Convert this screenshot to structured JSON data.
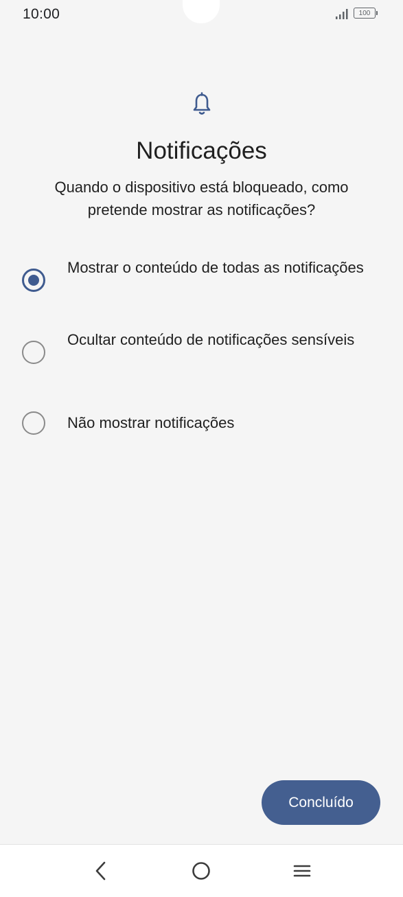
{
  "status_bar": {
    "time": "10:00",
    "battery": "100"
  },
  "header": {
    "icon": "bell-icon",
    "title": "Notificações",
    "subtitle": "Quando o dispositivo está bloqueado, como pretende mostrar as notificações?"
  },
  "options": [
    {
      "label": "Mostrar o conteúdo de todas as notificações",
      "selected": true
    },
    {
      "label": "Ocultar conteúdo de notificações sensíveis",
      "selected": false
    },
    {
      "label": "Não mostrar notificações",
      "selected": false
    }
  ],
  "actions": {
    "done_label": "Concluído"
  },
  "nav_bar": {
    "back_icon": "chevron-left-icon",
    "home_icon": "circle-home-icon",
    "menu_icon": "hamburger-menu-icon"
  },
  "colors": {
    "accent": "#445f90",
    "radio_selected": "#3f5b8f",
    "radio_unselected": "#8a8a8a",
    "background": "#f5f5f5"
  }
}
